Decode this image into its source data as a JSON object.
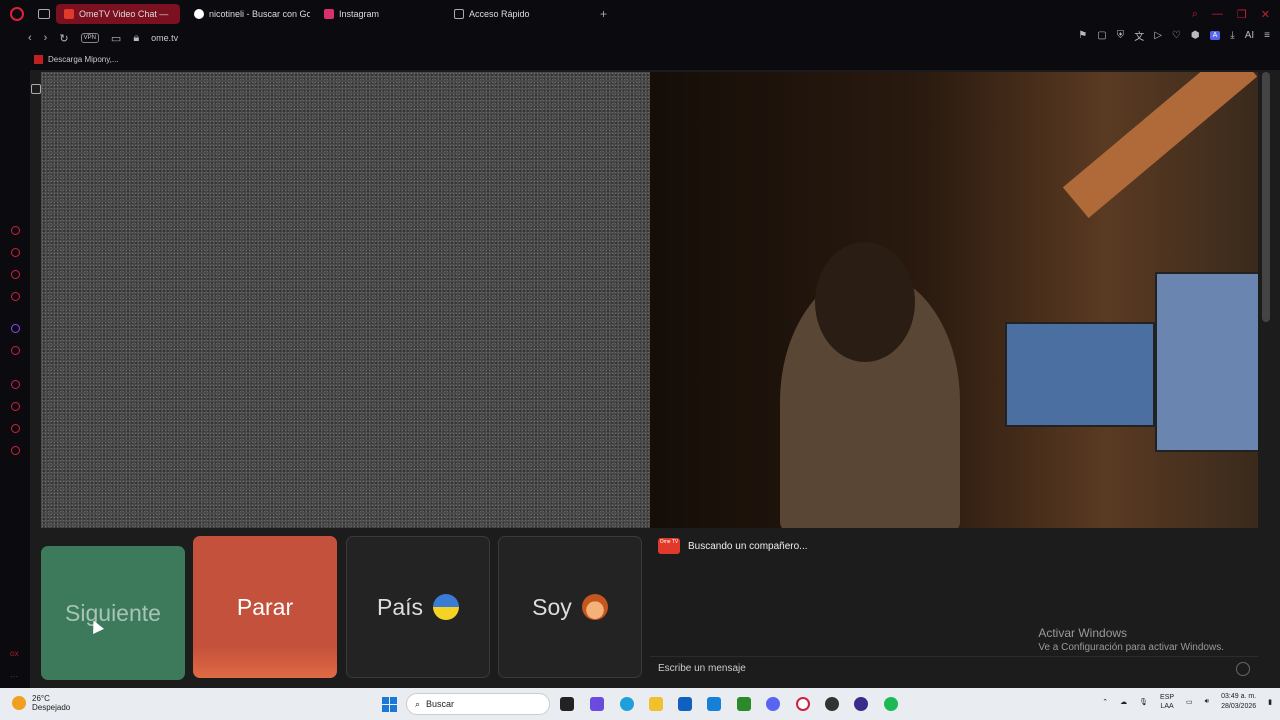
{
  "browser": {
    "tabs": [
      {
        "label": "OmeTV Video Chat — ",
        "active": true
      },
      {
        "label": "nicotineli - Buscar con Go",
        "active": false
      },
      {
        "label": "Instagram",
        "active": false
      },
      {
        "label": "Acceso Rápido",
        "active": false
      }
    ],
    "vpn_label": "VPN",
    "url": "ome.tv",
    "ai_label": "AI",
    "bookmark": "Descarga Mipony,..."
  },
  "sidebar": {
    "gx_label": "GX",
    "more_label": "···"
  },
  "controls": {
    "next_label": "Siguiente",
    "stop_label": "Parar",
    "country_label": "País",
    "gender_label": "Soy"
  },
  "chat": {
    "logo_text": "Ome TV",
    "status": "Buscando un compañero...",
    "placeholder": "Escribe un mensaje"
  },
  "watermark": {
    "title": "Activar Windows",
    "subtitle": "Ve a Configuración para activar Windows."
  },
  "taskbar": {
    "temperature": "26°C",
    "weather": "Despejado",
    "search_placeholder": "Buscar",
    "lang_top": "ESP",
    "lang_bottom": "LAA",
    "time": "03:49 a. m.",
    "date": "28/03/2026"
  }
}
